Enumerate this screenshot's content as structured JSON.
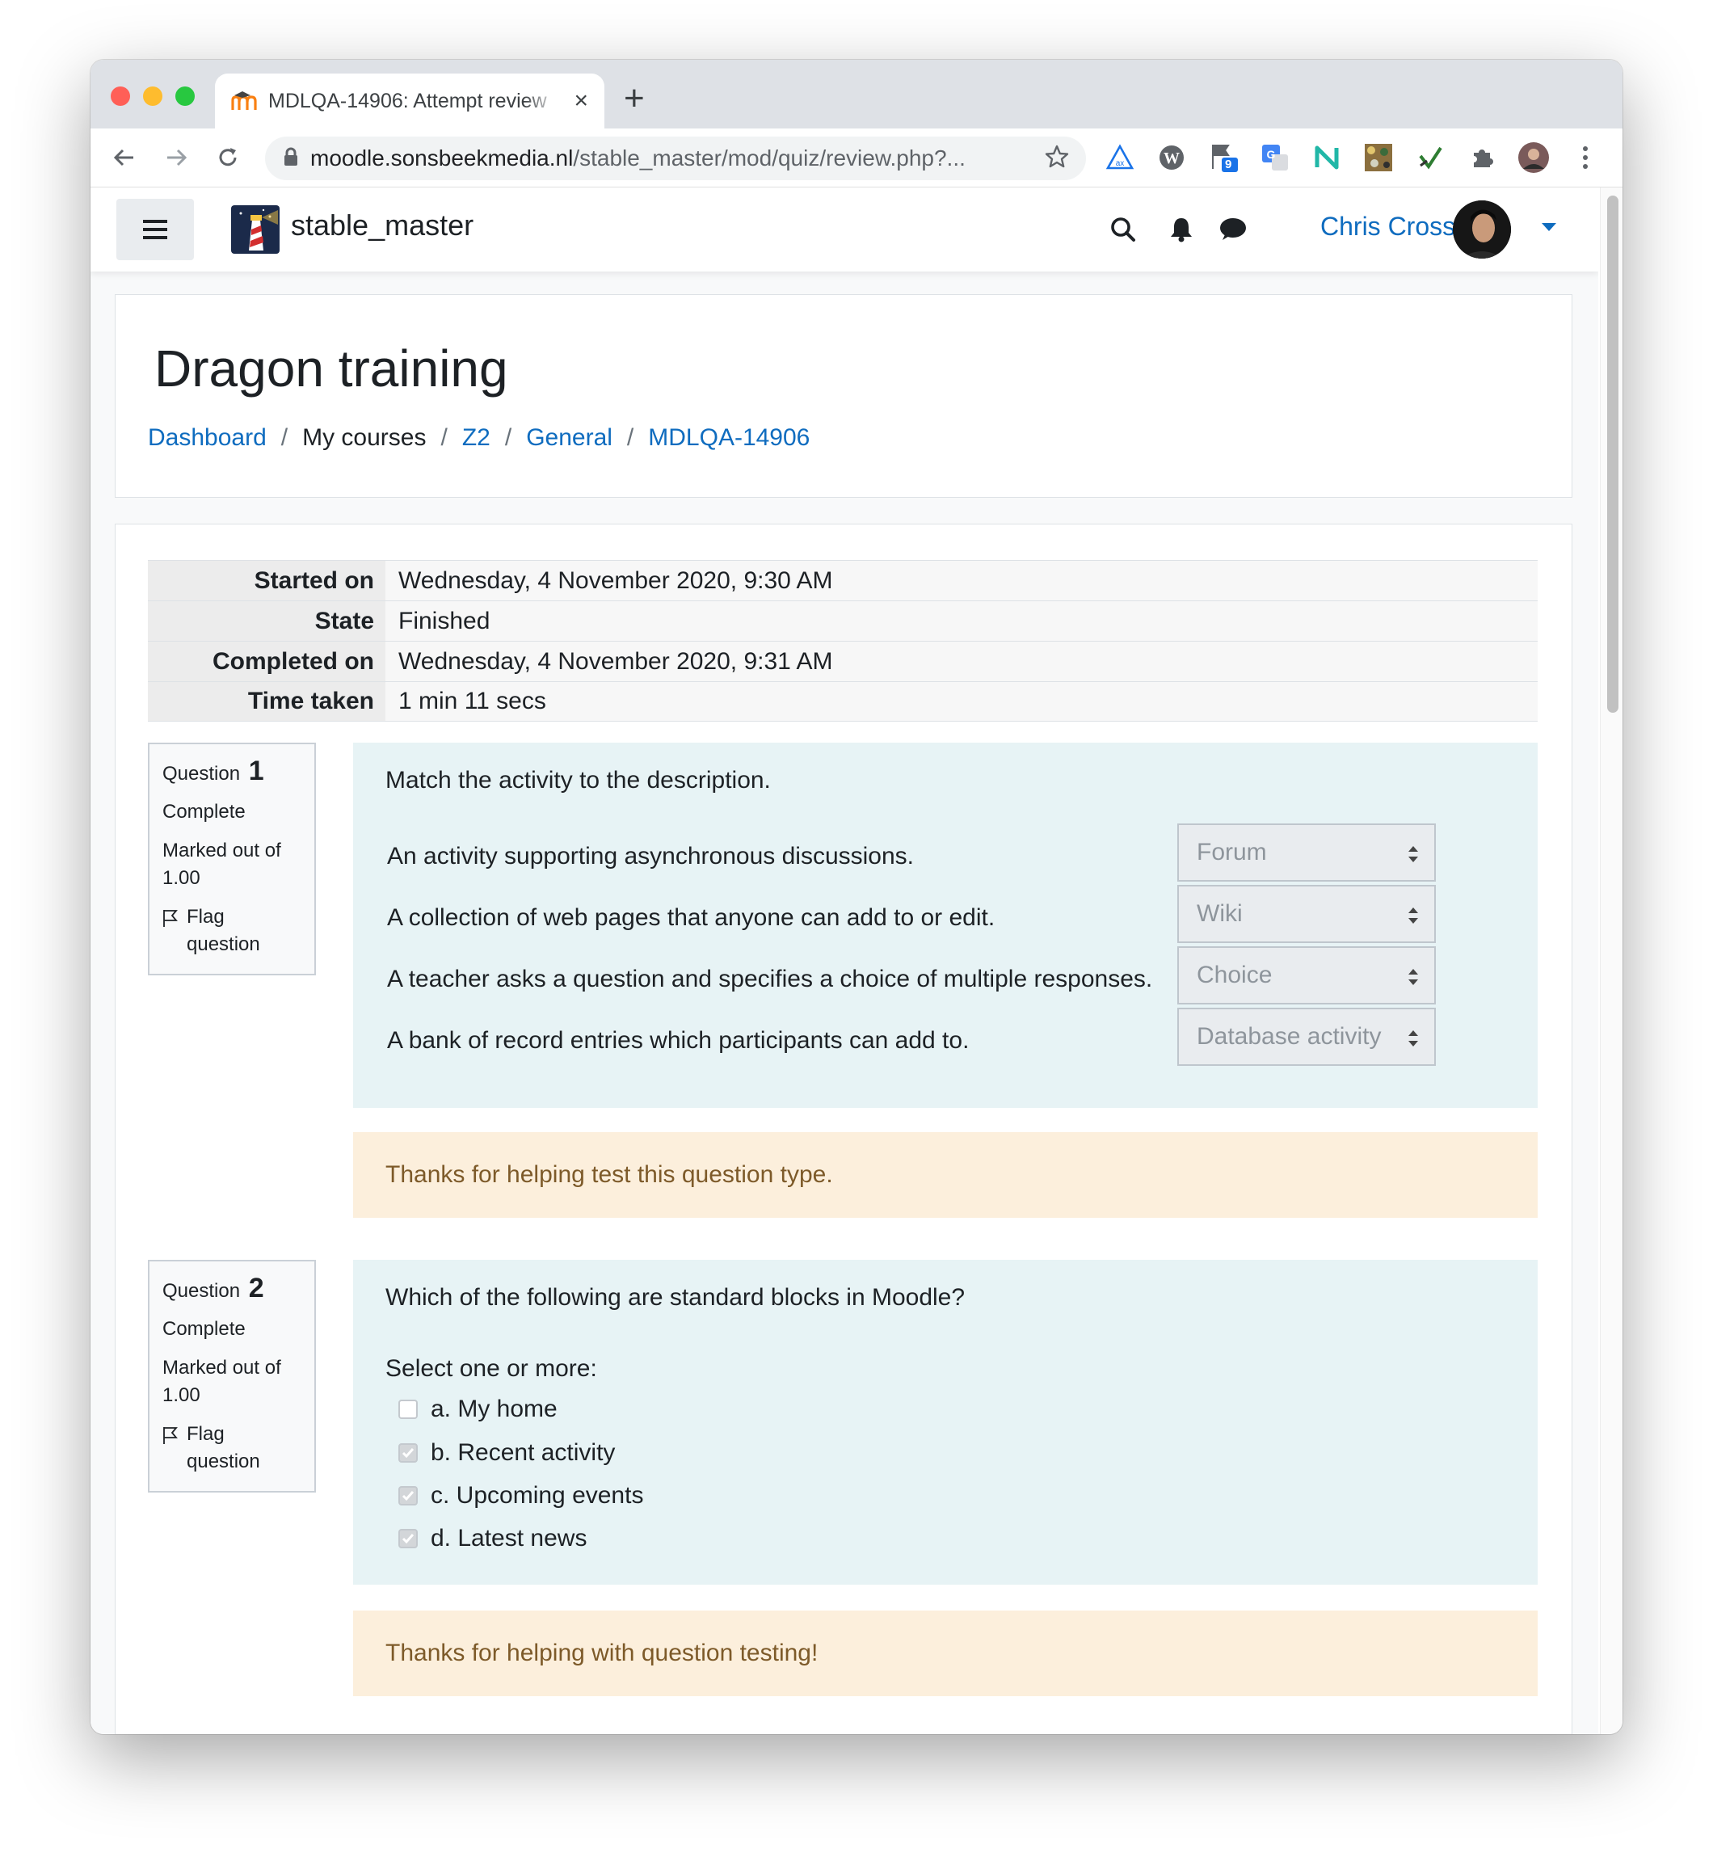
{
  "browser": {
    "tab_title": "MDLQA-14906: Attempt review",
    "tab_close": "×",
    "new_tab": "+",
    "url_host": "moodle.sonsbeekmedia.nl",
    "url_path": "/stable_master/mod/quiz/review.php?...",
    "extension_badge": "9"
  },
  "navbar": {
    "site_name": "stable_master",
    "user_name": "Chris Cross"
  },
  "header": {
    "course_title": "Dragon training",
    "breadcrumb": [
      {
        "label": "Dashboard",
        "link": true
      },
      {
        "label": "My courses",
        "link": false
      },
      {
        "label": "Z2",
        "link": true
      },
      {
        "label": "General",
        "link": true
      },
      {
        "label": "MDLQA-14906",
        "link": true
      }
    ],
    "separator": "/"
  },
  "summary": [
    {
      "label": "Started on",
      "value": "Wednesday, 4 November 2020, 9:30 AM"
    },
    {
      "label": "State",
      "value": "Finished"
    },
    {
      "label": "Completed on",
      "value": "Wednesday, 4 November 2020, 9:31 AM"
    },
    {
      "label": "Time taken",
      "value": "1 min 11 secs"
    }
  ],
  "questions": [
    {
      "info_label": "Question",
      "number": "1",
      "state": "Complete",
      "marked_out_of": "Marked out of 1.00",
      "flag_label": "Flag question",
      "text": "Match the activity to the description.",
      "matches": [
        {
          "stem": "An activity supporting asynchronous discussions.",
          "answer": "Forum"
        },
        {
          "stem": "A collection of web pages that anyone can add to or edit.",
          "answer": "Wiki"
        },
        {
          "stem": "A teacher asks a question and specifies a choice of multiple responses.",
          "answer": "Choice"
        },
        {
          "stem": "A bank of record entries which participants can add to.",
          "answer": "Database activity"
        }
      ],
      "feedback": "Thanks for helping test this question type."
    },
    {
      "info_label": "Question",
      "number": "2",
      "state": "Complete",
      "marked_out_of": "Marked out of 1.00",
      "flag_label": "Flag question",
      "text": "Which of the following are standard blocks in Moodle?",
      "prompt": "Select one or more:",
      "options": [
        {
          "label": "a. My home",
          "checked": false
        },
        {
          "label": "b. Recent activity",
          "checked": true
        },
        {
          "label": "c. Upcoming events",
          "checked": true
        },
        {
          "label": "d. Latest news",
          "checked": true
        }
      ],
      "feedback": "Thanks for helping with question testing!"
    }
  ],
  "colors": {
    "link": "#0f6cbf",
    "formulation_bg": "#e7f3f5",
    "feedback_bg": "#fcefdc",
    "feedback_text": "#7d5a29"
  }
}
